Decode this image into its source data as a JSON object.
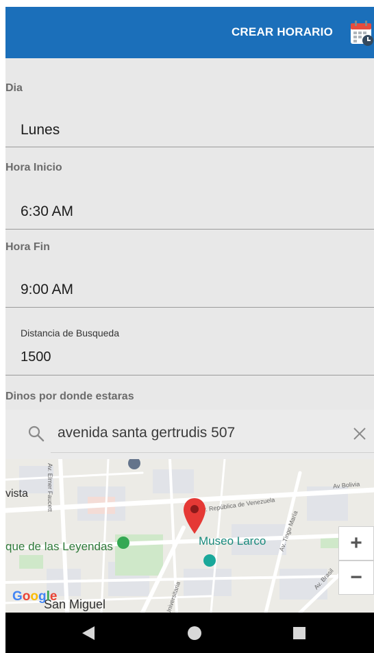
{
  "appbar": {
    "action_label": "CREAR HORARIO",
    "calendar_icon": "calendar-clock-icon",
    "color": "#1b6fba"
  },
  "form": {
    "day": {
      "label": "Dia",
      "value": "Lunes"
    },
    "start": {
      "label": "Hora Inicio",
      "value": "6:30 AM"
    },
    "end": {
      "label": "Hora Fin",
      "value": "9:00 AM"
    },
    "distance": {
      "label": "Distancia de Busqueda",
      "value": "1500"
    },
    "location_label": "Dinos por donde estaras"
  },
  "search": {
    "icon": "search-icon",
    "value": "avenida santa gertrudis 507",
    "clear_icon": "close-icon"
  },
  "map": {
    "places": {
      "vista": "vista",
      "park": "que de las Leyendas",
      "museum": "Museo Larco",
      "san_miguel": "San Miguel"
    },
    "roads": {
      "elmer": "Av. Elmer Faucett",
      "venezuela": "Av. República de Venezuela",
      "bolivia": "Av Bolivia",
      "tingo": "Av. Tingo María",
      "universitaria": "Av. Universitaria",
      "brasil": "Av. Brasil"
    },
    "zoom_in": "+",
    "zoom_out": "−",
    "google": [
      "G",
      "o",
      "o",
      "g",
      "l",
      "e"
    ],
    "marker_color": "#e53935"
  },
  "navbar": {
    "back_icon": "back-triangle-icon",
    "home_icon": "home-circle-icon",
    "recents_icon": "recents-square-icon"
  }
}
